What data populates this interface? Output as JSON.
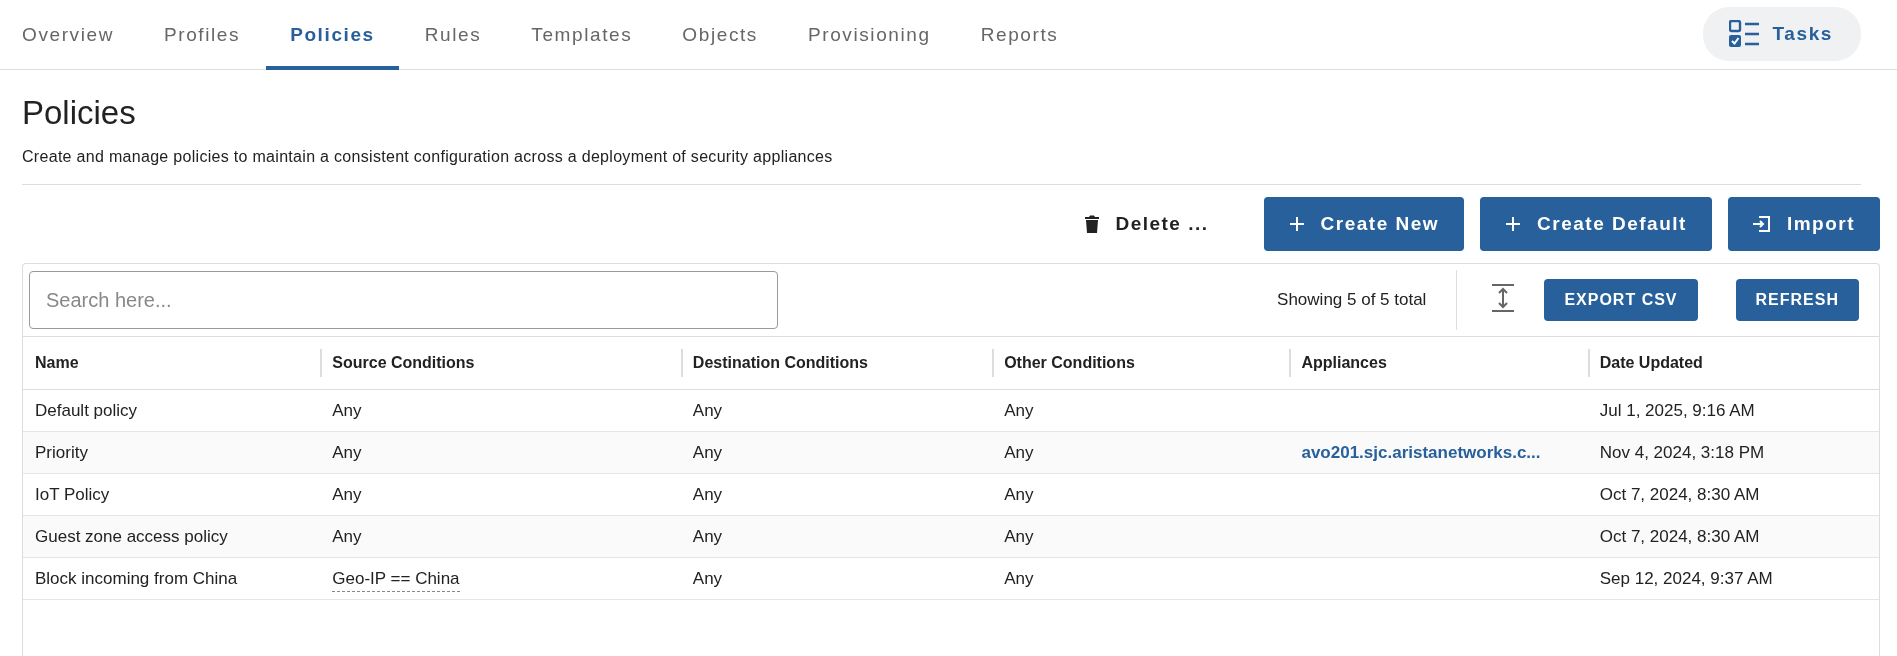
{
  "tabs": [
    {
      "label": "Overview",
      "selected": false
    },
    {
      "label": "Profiles",
      "selected": false
    },
    {
      "label": "Policies",
      "selected": true
    },
    {
      "label": "Rules",
      "selected": false
    },
    {
      "label": "Templates",
      "selected": false
    },
    {
      "label": "Objects",
      "selected": false
    },
    {
      "label": "Provisioning",
      "selected": false
    },
    {
      "label": "Reports",
      "selected": false
    }
  ],
  "tasks_button": {
    "label": "Tasks"
  },
  "header": {
    "title": "Policies",
    "description": "Create and manage policies to maintain a consistent configuration across a deployment of security appliances"
  },
  "actions": [
    {
      "kind": "delete",
      "label": "Delete ..."
    },
    {
      "kind": "create",
      "label": "Create New"
    },
    {
      "kind": "create",
      "label": "Create Default"
    },
    {
      "kind": "import",
      "label": "Import"
    }
  ],
  "table": {
    "search": {
      "placeholder": "Search here..."
    },
    "count": "Showing 5 of 5 total",
    "toolbar_buttons": [
      "EXPORT CSV",
      "REFRESH"
    ],
    "columns": [
      "Name",
      "Source Conditions",
      "Destination Conditions",
      "Other Conditions",
      "Appliances",
      "Date Updated"
    ],
    "rows": [
      {
        "name": "Default policy",
        "source_conditions": {
          "text": "Any",
          "kind": "plain"
        },
        "destination_conditions": "Any",
        "other_conditions": "Any",
        "date_updated": "Jul 1, 2025, 9:16 AM"
      },
      {
        "name": "Priority",
        "source_conditions": {
          "text": "Any",
          "kind": "plain"
        },
        "destination_conditions": "Any",
        "other_conditions": "Any",
        "appliances": "avo201.sjc.aristanetworks.c...",
        "date_updated": "Nov 4, 2024, 3:18 PM"
      },
      {
        "name": "IoT Policy",
        "source_conditions": {
          "text": "Any",
          "kind": "plain"
        },
        "destination_conditions": "Any",
        "other_conditions": "Any",
        "date_updated": "Oct 7, 2024, 8:30 AM"
      },
      {
        "name": "Guest zone access policy",
        "source_conditions": {
          "text": "Any",
          "kind": "plain"
        },
        "destination_conditions": "Any",
        "other_conditions": "Any",
        "date_updated": "Oct 7, 2024, 8:30 AM"
      },
      {
        "name": "Block incoming from China",
        "source_conditions": {
          "text": "Geo-IP == China",
          "kind": "hint"
        },
        "destination_conditions": "Any",
        "other_conditions": "Any",
        "date_updated": "Sep 12, 2024, 9:37 AM"
      }
    ]
  }
}
